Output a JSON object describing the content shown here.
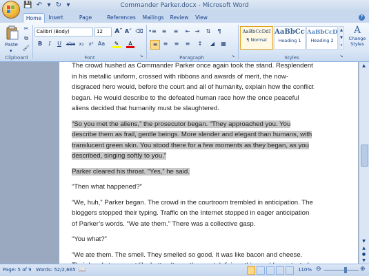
{
  "window": {
    "title": "Commander Parker.docx - Microsoft Word"
  },
  "tabs": [
    "Home",
    "Insert",
    "Page Layout",
    "References",
    "Mailings",
    "Review",
    "View"
  ],
  "ribbon": {
    "clipboard": {
      "label": "Clipboard",
      "paste": "Paste"
    },
    "font": {
      "label": "Font",
      "name": "Calibri (Body)",
      "size": "12"
    },
    "paragraph": {
      "label": "Paragraph"
    },
    "styles": {
      "label": "Styles",
      "items": [
        {
          "preview": "AaBbCcDdI",
          "name": "¶ Normal"
        },
        {
          "preview": "AaBbCc",
          "name": "Heading 1"
        },
        {
          "preview": "AaBbCcD",
          "name": "Heading 2"
        }
      ],
      "change": "Change Styles"
    }
  },
  "document": {
    "paragraphs": [
      {
        "text": "The crowd hushed as Commander Parker once again took the stand. Resplendent in his metallic uniform, crossed with ribbons and awards of merit, the now-disgraced hero would, before the court and all of humanity, explain how the conflict began. He would describe to the defeated human race how the once peaceful aliens decided that humanity must be slaughtered.",
        "highlight": false
      },
      {
        "text": "“So you met the aliens,” the prosecutor began. “They approached you. You describe them as frail, gentle beings. More slender and elegant than humans, with translucent green skin. You stood there for a few moments as they began, as you described, singing softly to you.”",
        "highlight": true
      },
      {
        "text": "Parker cleared his throat. “Yes,” he said.",
        "highlight": true
      },
      {
        "text": "“Then what happened?”",
        "highlight": false
      },
      {
        "text": "“We, huh,” Parker began. The crowd in the courtroom trembled in anticipation. The bloggers stopped their typing. Traffic on the Internet stopped in eager anticipation of Parker’s words. “We ate them.” There was a collective gasp.",
        "highlight": false
      },
      {
        "text": "“You what?”",
        "highlight": false
      },
      {
        "text": "“We ate them. The smell. They smelled so good. It was like bacon and cheese. Their heads tore apart like butter. It was the most delicious thing we’d ever tasted. And then we wanted more.”",
        "highlight": false
      }
    ]
  },
  "status": {
    "page": "Page: 5 of 9",
    "words": "Words: 52/2,665",
    "zoom": "110%"
  }
}
